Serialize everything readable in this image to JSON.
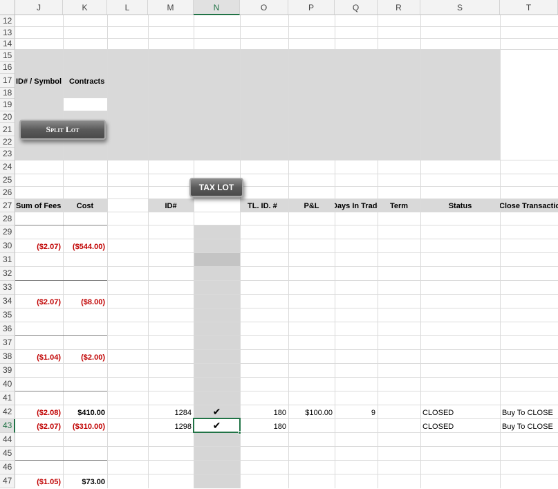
{
  "columns": [
    {
      "id": "col-j",
      "label": "J"
    },
    {
      "id": "col-k",
      "label": "K"
    },
    {
      "id": "col-l",
      "label": "L"
    },
    {
      "id": "col-m",
      "label": "M"
    },
    {
      "id": "col-n",
      "label": "N"
    },
    {
      "id": "col-o",
      "label": "O"
    },
    {
      "id": "col-p",
      "label": "P"
    },
    {
      "id": "col-q",
      "label": "Q"
    },
    {
      "id": "col-r",
      "label": "R"
    },
    {
      "id": "col-s",
      "label": "S"
    },
    {
      "id": "col-t",
      "label": "T"
    }
  ],
  "rows": [
    "12",
    "13",
    "14",
    "15",
    "16",
    "17",
    "18",
    "19",
    "20",
    "21",
    "22",
    "23",
    "24",
    "25",
    "26",
    "27",
    "28",
    "29",
    "30",
    "31",
    "32",
    "33",
    "34",
    "35",
    "36",
    "37",
    "38",
    "39",
    "40",
    "41",
    "42",
    "43",
    "44",
    "45",
    "46",
    "47"
  ],
  "panel": {
    "id_symbol_label": "ID# / Symbol",
    "contracts_label": "Contracts",
    "split_lot_label": "Split Lot"
  },
  "tax_lot_label": "TAX LOT",
  "headers": {
    "sum_of_fees": "Sum of Fees",
    "cost": "Cost",
    "id": "ID#",
    "tl_id": "TL. ID. #",
    "pl": "P&L",
    "days_in_trade": "Days In Trade",
    "term": "Term",
    "status": "Status",
    "close_transaction": "Close Transaction"
  },
  "fees": [
    {
      "fee": "($2.07)",
      "cost": "($544.00)"
    },
    {
      "fee": "($2.07)",
      "cost": "($8.00)"
    },
    {
      "fee": "($1.04)",
      "cost": "($2.00)"
    },
    {
      "fee": "($2.08)",
      "cost": "$410.00"
    },
    {
      "fee": "($2.07)",
      "cost": "($310.00)"
    },
    {
      "fee": "($1.05)",
      "cost": "$73.00"
    }
  ],
  "trades": [
    {
      "id": "1284",
      "check": "✔",
      "tl_id": "180",
      "pl": "$100.00",
      "days": "9",
      "status": "CLOSED",
      "close": "Buy To CLOSE"
    },
    {
      "id": "1298",
      "check": "✔",
      "tl_id": "180",
      "pl": "",
      "days": "",
      "status": "CLOSED",
      "close": "Buy To CLOSE"
    }
  ]
}
